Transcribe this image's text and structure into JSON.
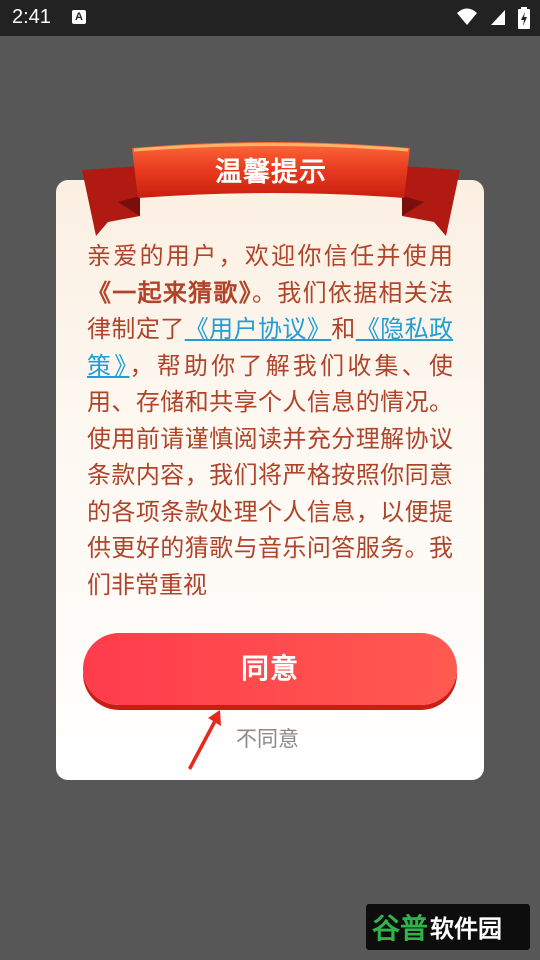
{
  "status_bar": {
    "time": "2:41",
    "notification_icon_letter": "A",
    "icons": [
      "wifi-icon",
      "cellular-signal-icon",
      "battery-charging-icon"
    ]
  },
  "dialog": {
    "title": "温馨提示",
    "body_parts": {
      "intro": "亲爱的用户，欢迎你信任并使用",
      "app_name": "《一起来猜歌》",
      "after_app": "。我们依据相关法律制定了",
      "link_user_agreement": "《用户协议》",
      "and": "和",
      "link_privacy": "《隐私政策》",
      "rest": "，帮助你了解我们收集、使用、存储和共享个人信息的情况。使用前请谨慎阅读并充分理解协议条款内容，我们将严格按照你同意的各项条款处理个人信息，以便提供更好的猜歌与音乐问答服务。我们非常重视"
    },
    "agree_label": "同意",
    "decline_label": "不同意"
  },
  "watermark": {
    "text": "谷普软件园"
  },
  "colors": {
    "overlay": "#575757",
    "status_bar": "#222222",
    "body_text": "#b0442a",
    "link": "#1f9ed8",
    "agree_button": "#ff4a4e",
    "ribbon_red": "#e42d1c"
  }
}
